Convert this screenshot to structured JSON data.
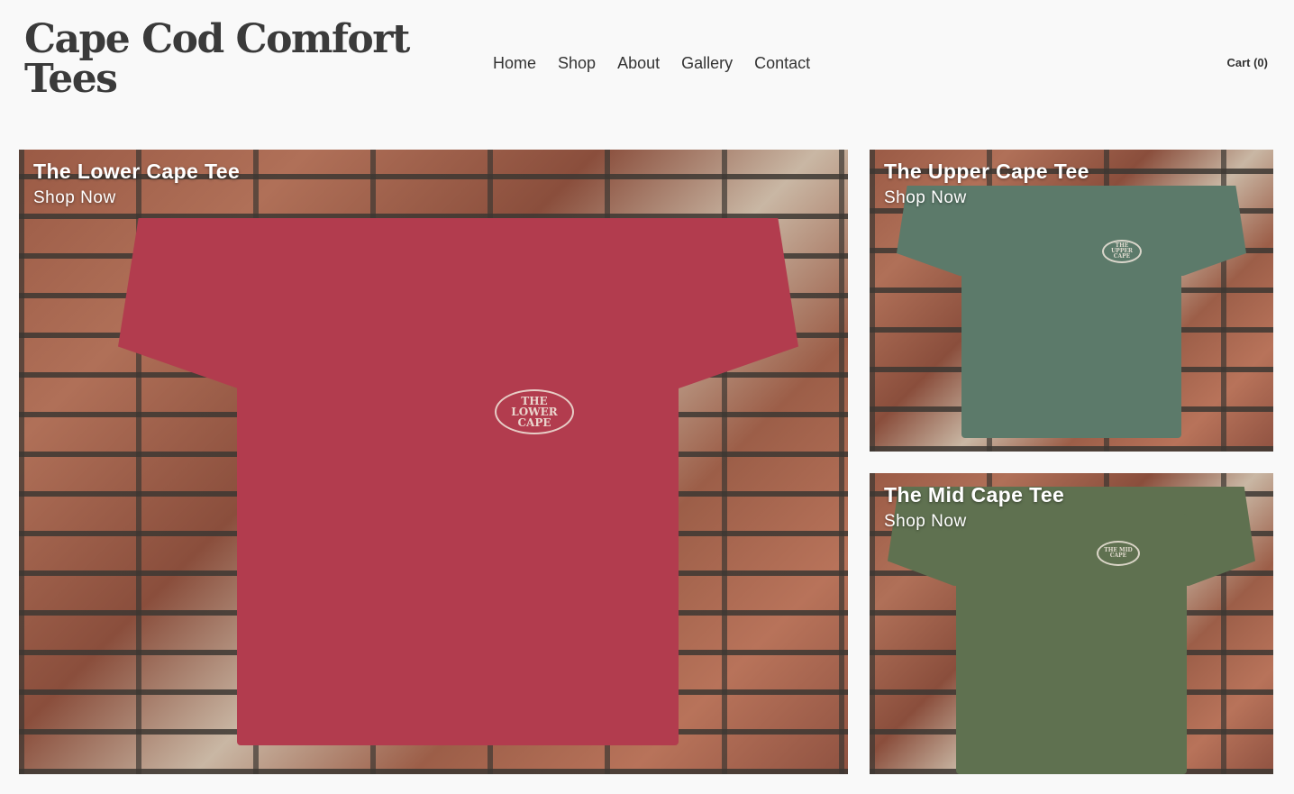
{
  "site": {
    "title": "Cape Cod Comfort Tees"
  },
  "nav": {
    "items": [
      {
        "label": "Home"
      },
      {
        "label": "Shop"
      },
      {
        "label": "About"
      },
      {
        "label": "Gallery"
      },
      {
        "label": "Contact"
      }
    ],
    "cart_label": "Cart (0)"
  },
  "tiles": [
    {
      "title": "The Lower Cape Tee",
      "cta": "Shop Now",
      "shirt_color": "#b23c4e",
      "logo_text": "THE LOWER CAPE"
    },
    {
      "title": "The Upper Cape Tee",
      "cta": "Shop Now",
      "shirt_color": "#5c7a6a",
      "logo_text": "THE UPPER CAPE"
    },
    {
      "title": "The Mid Cape Tee",
      "cta": "Shop Now",
      "shirt_color": "#5f7150",
      "logo_text": "THE MID CAPE"
    }
  ]
}
